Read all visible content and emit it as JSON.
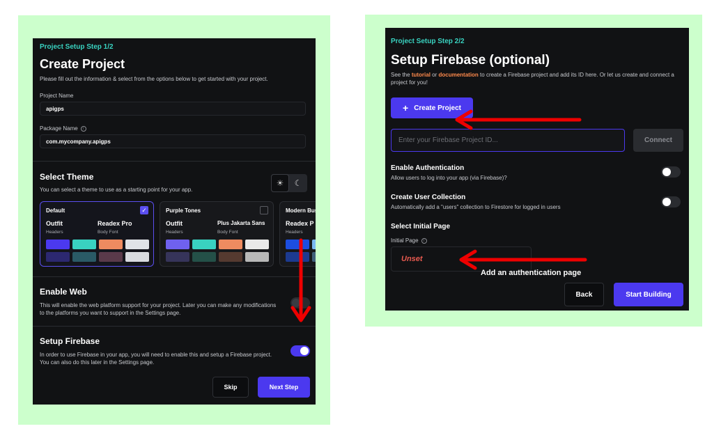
{
  "left": {
    "step_label": "Project Setup Step 1/2",
    "title": "Create Project",
    "description": "Please fill out the information & select from the options below to get started with your project.",
    "project_name_label": "Project Name",
    "project_name_value": "apigps",
    "package_name_label": "Package Name",
    "package_name_value": "com.mycompany.apigps",
    "select_theme_title": "Select Theme",
    "select_theme_desc": "You can select a theme to use as a starting point for your app.",
    "themes": [
      {
        "name": "Default",
        "header_font": "Outfit",
        "body_font": "Readex Pro",
        "header_role": "Headers",
        "body_role": "Body Font",
        "selected": true,
        "swatches": [
          "#4b39ef",
          "#39d2c0",
          "#ee8b60",
          "#e0e3e7",
          "#2c2870",
          "#2a5a66",
          "#5a3a4a",
          "#d9dbe0"
        ]
      },
      {
        "name": "Purple Tones",
        "header_font": "Outfit",
        "body_font": "Plus Jakarta Sans",
        "header_role": "Headers",
        "body_role": "Body Font",
        "selected": false,
        "swatches": [
          "#6f61ef",
          "#39d2c0",
          "#ee8b60",
          "#e9e9e9",
          "#36345a",
          "#245048",
          "#553a30",
          "#b8b8b8"
        ]
      },
      {
        "name": "Modern Bus",
        "header_font": "Readex P",
        "body_font": "",
        "header_role": "Headers",
        "body_role": "",
        "selected": false,
        "swatches": [
          "#1c4ee0",
          "#7ab8f0",
          "#1c3a90",
          "#40607a"
        ]
      }
    ],
    "enable_web_title": "Enable Web",
    "enable_web_desc": "This will enable the web platform support for your project. Later you can make any modifications to the platforms you want to support in the Settings page.",
    "setup_firebase_title": "Setup Firebase",
    "setup_firebase_desc": "In order to use Firebase in your app, you will need to enable this and setup a Firebase project. You can also do this later in the Settings page.",
    "skip_label": "Skip",
    "next_label": "Next Step"
  },
  "right": {
    "step_label": "Project Setup Step 2/2",
    "title": "Setup Firebase (optional)",
    "desc_pre": "See the ",
    "tutorial_link": "tutorial",
    "desc_or": " or ",
    "documentation_link": "documentation",
    "desc_post": " to create a Firebase project and add its ID here. Or let us create and connect a project for you!",
    "create_project_label": "Create Project",
    "project_id_placeholder": "Enter your Firebase Project ID...",
    "connect_label": "Connect",
    "enable_auth_title": "Enable Authentication",
    "enable_auth_desc": "Allow users to log into your app (via Firebase)?",
    "create_user_title": "Create User Collection",
    "create_user_desc": "Automatically add a \"users\" collection to Firestore for logged in users",
    "select_initial_title": "Select Initial Page",
    "initial_page_label": "Initial Page",
    "initial_page_value": "Unset",
    "back_label": "Back",
    "start_label": "Start Building"
  },
  "annotation": "Add an authentication page",
  "colors": {
    "accent": "#4b39ef",
    "teal": "#39d2c0",
    "orange": "#ff8a4c",
    "arrow": "#ee0000",
    "frame": "#ccffcc",
    "panel": "#111214"
  },
  "icons": [
    "info-icon",
    "sun-icon",
    "moon-icon",
    "check-icon",
    "plus-icon",
    "arrow-annotation"
  ]
}
